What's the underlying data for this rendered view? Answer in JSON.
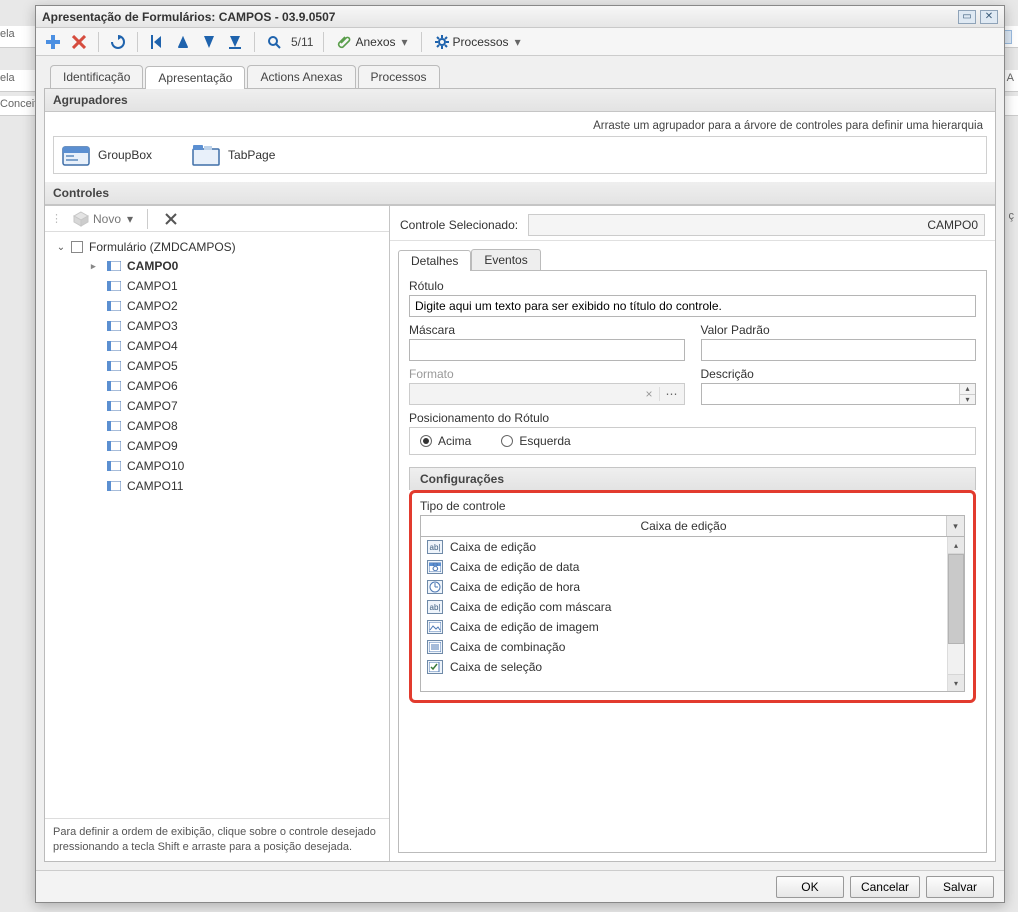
{
  "bg": {
    "l1": "ela",
    "l2": "ela",
    "l3": "Conceit",
    "r1": "A",
    "r2": "ç"
  },
  "window": {
    "title": "Apresentação de Formulários: CAMPOS - 03.9.0507"
  },
  "toolbar": {
    "pageCount": "5/11",
    "anexos": "Anexos",
    "processos": "Processos"
  },
  "tabs": {
    "identificacao": "Identificação",
    "apresentacao": "Apresentação",
    "actionsAnexas": "Actions Anexas",
    "processos": "Processos"
  },
  "agrupadores": {
    "title": "Agrupadores",
    "hint": "Arraste um agrupador para a árvore de controles para definir uma hierarquia",
    "groupbox": "GroupBox",
    "tabpage": "TabPage"
  },
  "controles": {
    "title": "Controles",
    "novo": "Novo",
    "rootLabel": "Formulário (ZMDCAMPOS)",
    "items": [
      "CAMPO0",
      "CAMPO1",
      "CAMPO2",
      "CAMPO3",
      "CAMPO4",
      "CAMPO5",
      "CAMPO6",
      "CAMPO7",
      "CAMPO8",
      "CAMPO9",
      "CAMPO10",
      "CAMPO11"
    ],
    "selectedIndex": 0,
    "help": "Para definir a ordem de exibição, clique sobre o controle desejado pressionando a tecla Shift e arraste para a posição desejada."
  },
  "right": {
    "controleSelecionadoLabel": "Controle Selecionado:",
    "controleSelecionadoValue": "CAMPO0",
    "tabs": {
      "detalhes": "Detalhes",
      "eventos": "Eventos"
    },
    "detalhes": {
      "rotuloLabel": "Rótulo",
      "rotuloValue": "Digite aqui um texto para ser exibido no título do controle.",
      "mascaraLabel": "Máscara",
      "mascaraValue": "",
      "valorPadraoLabel": "Valor Padrão",
      "valorPadraoValue": "",
      "formatoLabel": "Formato",
      "formatoValue": "",
      "descricaoLabel": "Descrição",
      "descricaoValue": "",
      "posicionamentoLabel": "Posicionamento do Rótulo",
      "acima": "Acima",
      "esquerda": "Esquerda"
    },
    "config": {
      "title": "Configurações",
      "tipoControleLabel": "Tipo de controle",
      "selected": "Caixa de edição",
      "options": [
        {
          "icon": "abl",
          "label": "Caixa de edição"
        },
        {
          "icon": "date",
          "label": "Caixa de edição de data"
        },
        {
          "icon": "clock",
          "label": "Caixa de edição de hora"
        },
        {
          "icon": "abl",
          "label": "Caixa de edição com máscara"
        },
        {
          "icon": "img",
          "label": "Caixa de edição de imagem"
        },
        {
          "icon": "combo",
          "label": "Caixa de combinação"
        },
        {
          "icon": "check",
          "label": "Caixa de seleção"
        }
      ]
    }
  },
  "footer": {
    "ok": "OK",
    "cancelar": "Cancelar",
    "salvar": "Salvar"
  }
}
